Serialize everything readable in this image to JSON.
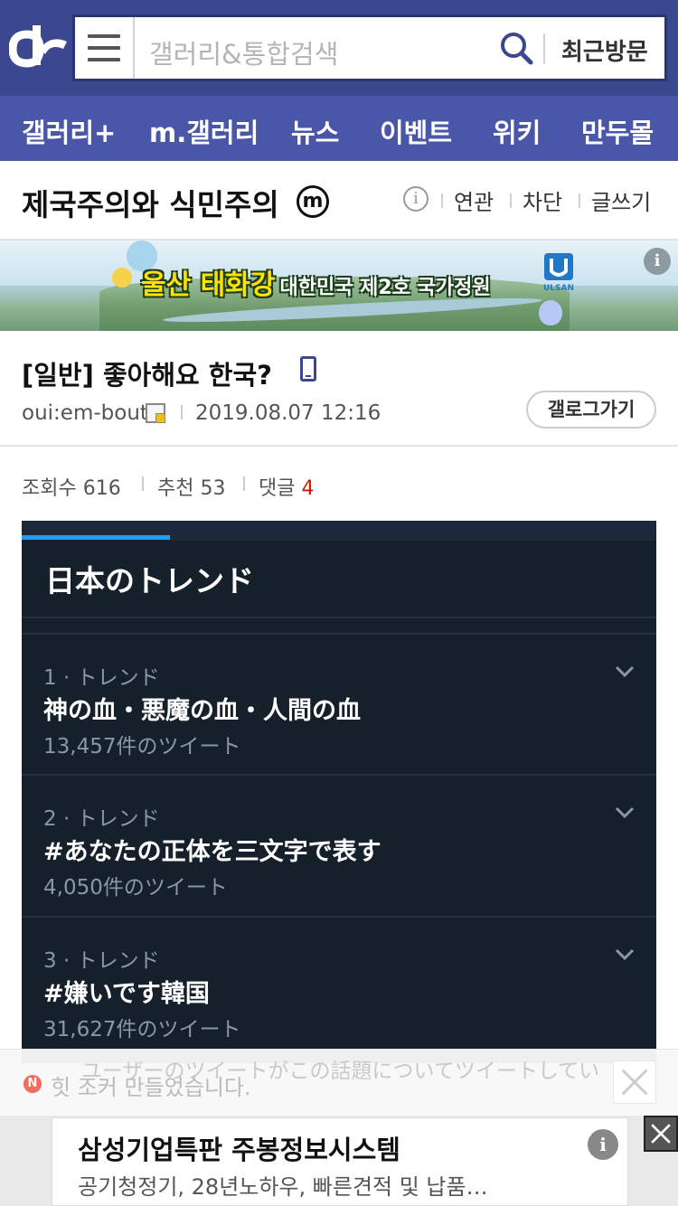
{
  "header": {
    "search_placeholder": "갤러리&통합검색",
    "recent_label": "최근방문",
    "accent_color": "#3b4890"
  },
  "nav": {
    "items": [
      "갤러리+",
      "m.갤러리",
      "뉴스",
      "이벤트",
      "위키",
      "만두몰"
    ]
  },
  "gallery": {
    "title": "제국주의와 식민주의",
    "badge": "m",
    "links": [
      "연관",
      "차단",
      "글쓰기"
    ]
  },
  "banner": {
    "headline": "울산 태화강",
    "subline": "대한민국 제2호 국가정원",
    "logo_text": "ULSAN",
    "info_label": "i"
  },
  "post": {
    "title": "[일반] 좋아해요 한국?",
    "author": "oui:em-bout",
    "datetime": "2019.08.07 12:16",
    "gallery_button": "갤로그가기",
    "views_label": "조회수 616",
    "likes_label": "추천 53",
    "comments_label": "댓글",
    "comments_count": "4"
  },
  "embedded_screenshot": {
    "heading": "日本のトレンド",
    "trends": [
      {
        "rank": "1 · トレンド",
        "name": "神の血・悪魔の血・人間の血",
        "count": "13,457件のツイート"
      },
      {
        "rank": "2 · トレンド",
        "name": "#あなたの正体を三文字で表す",
        "count": "4,050件のツイート"
      },
      {
        "rank": "3 · トレンド",
        "name": "#嫌いです韓国",
        "count": "31,627件のツイート"
      }
    ],
    "cut_off_text": "ユーザーのツイートがこの話題についてツイートしてい"
  },
  "notice": {
    "icon": "N",
    "text": "힛  조커 만들었습니다."
  },
  "bottom_ad": {
    "title": "삼성기업특판 주봉정보시스템",
    "description": "공기청정기, 28년노하우, 빠른견적 및 납품…",
    "info_label": "i"
  }
}
